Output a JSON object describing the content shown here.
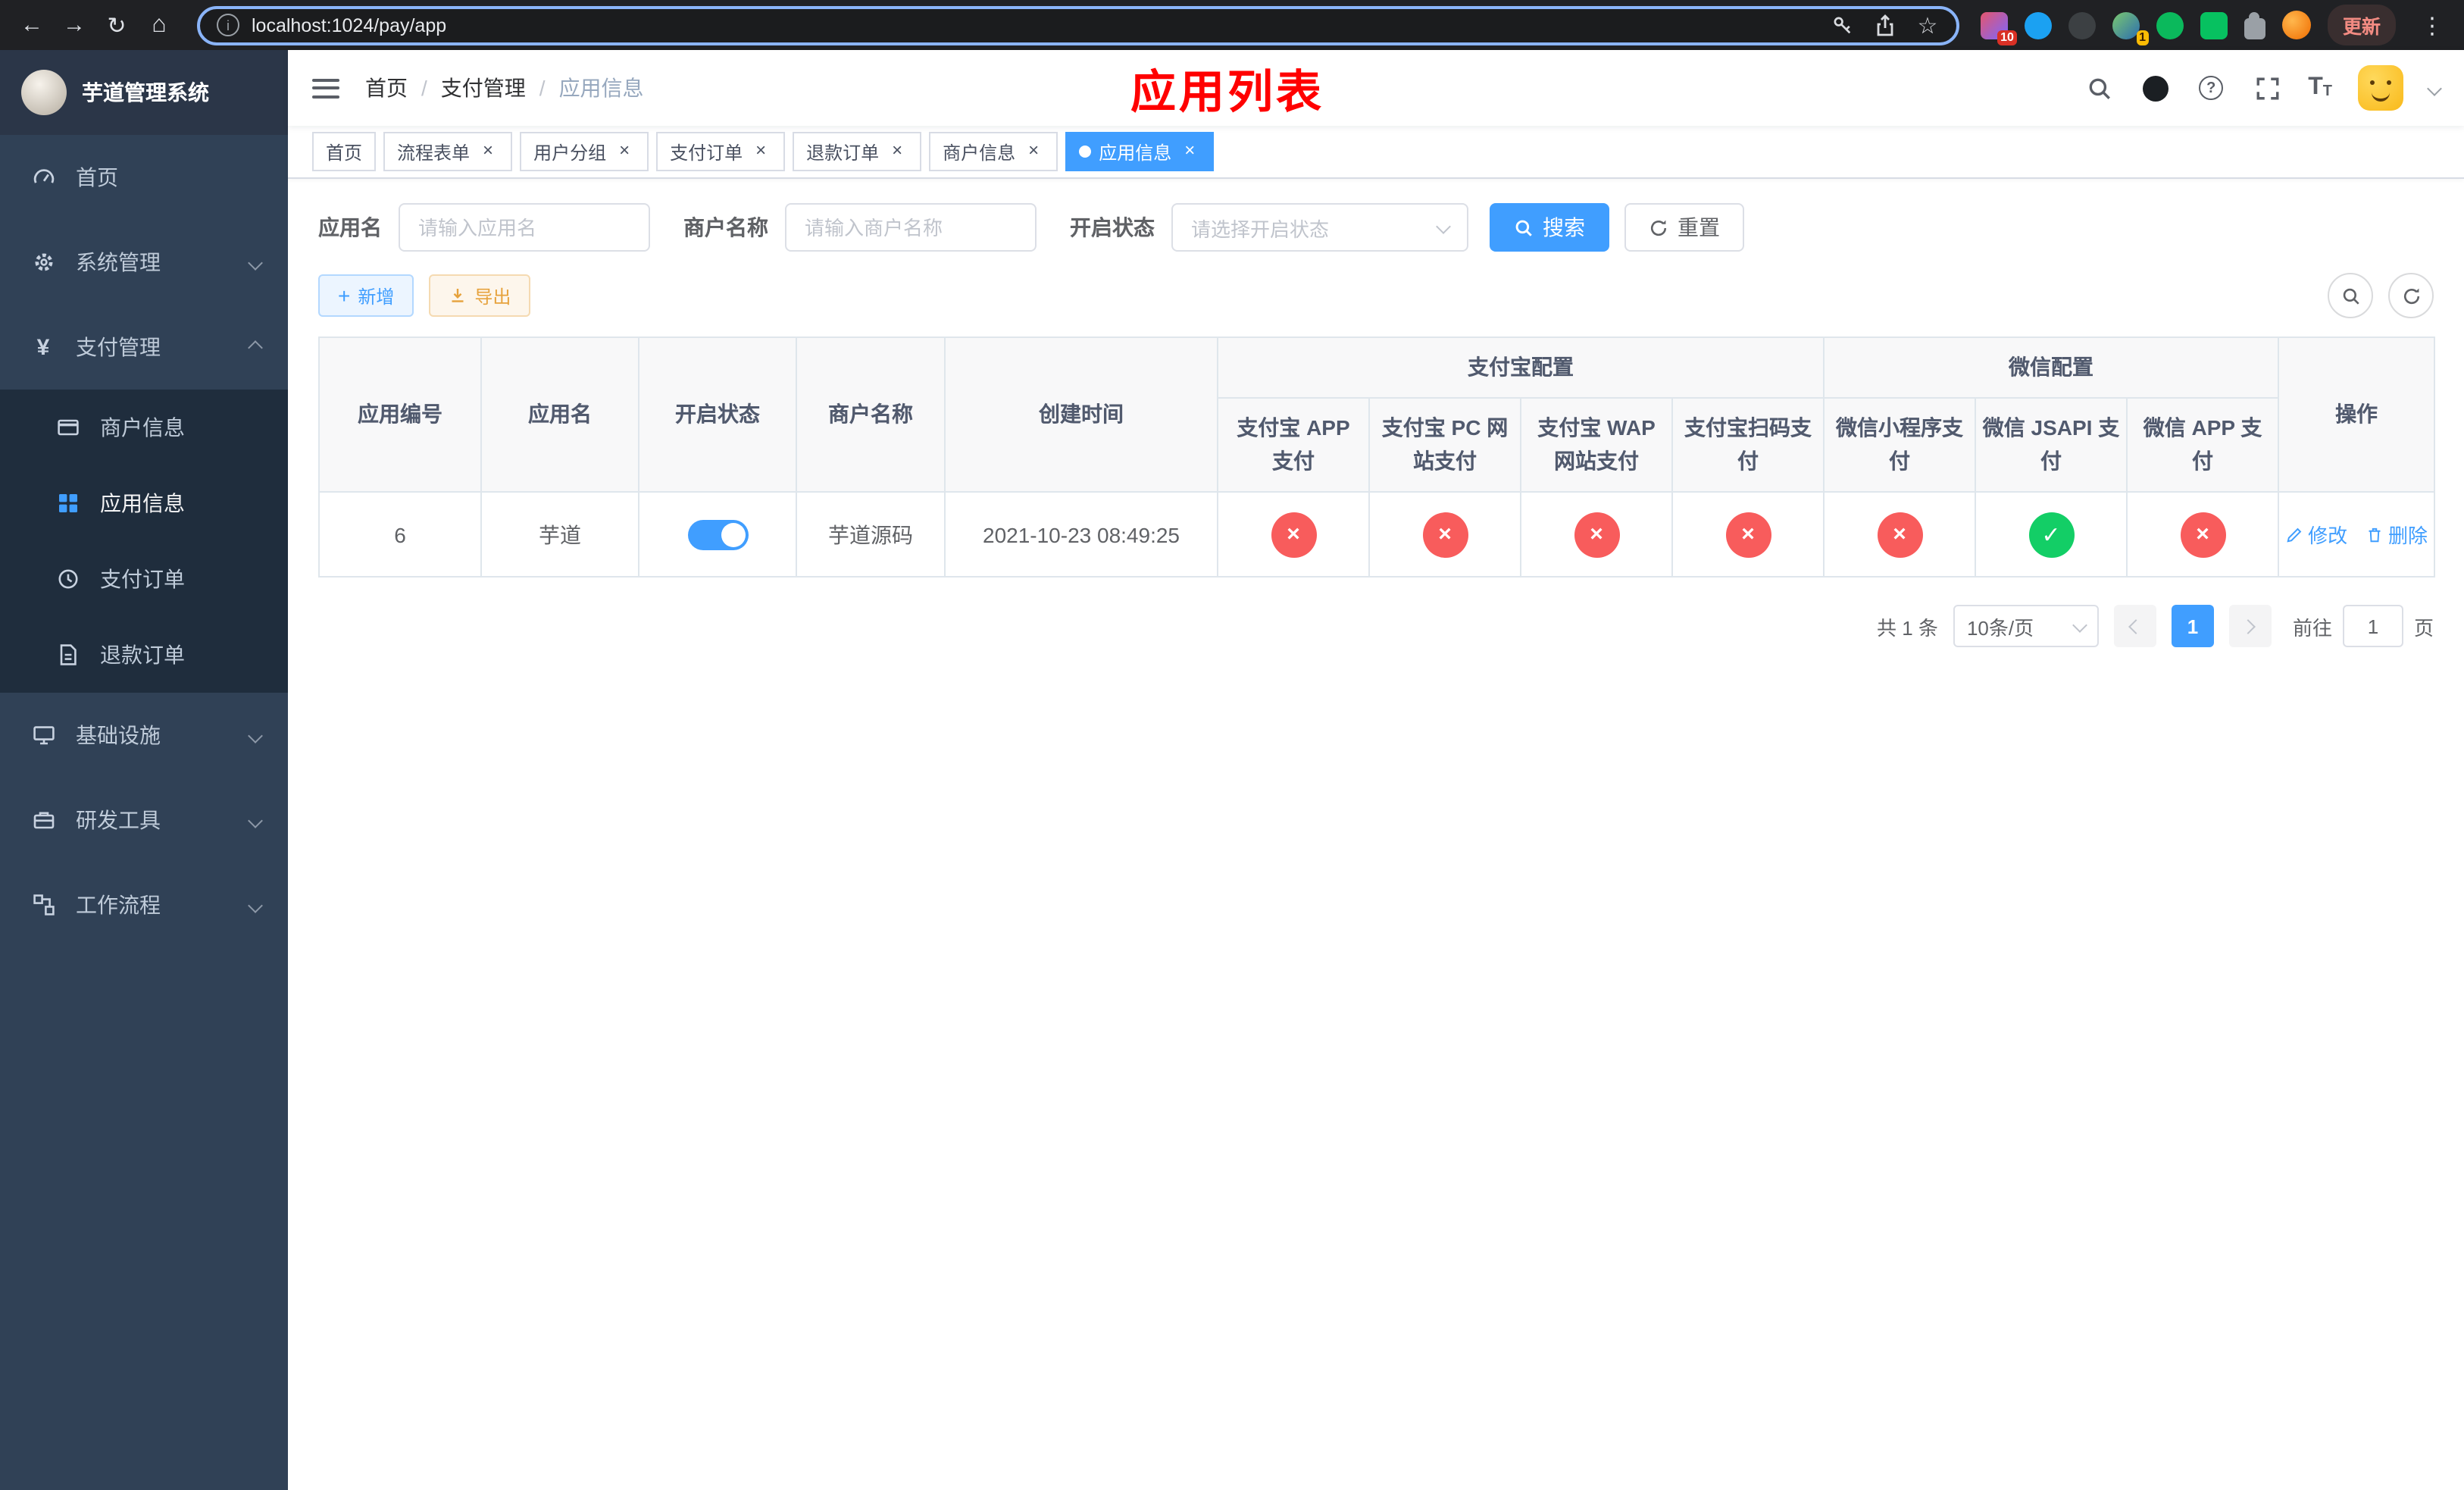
{
  "browser": {
    "url": "localhost:1024/pay/app",
    "update_button": "更新",
    "ext_badge_1": "10",
    "ext_badge_2": "1"
  },
  "sidebar": {
    "app_title": "芋道管理系统",
    "menu": [
      {
        "label": "首页"
      },
      {
        "label": "系统管理"
      },
      {
        "label": "支付管理"
      },
      {
        "label": "基础设施"
      },
      {
        "label": "研发工具"
      },
      {
        "label": "工作流程"
      }
    ],
    "submenu_pay": [
      {
        "label": "商户信息"
      },
      {
        "label": "应用信息",
        "active": true
      },
      {
        "label": "支付订单"
      },
      {
        "label": "退款订单"
      }
    ]
  },
  "header": {
    "breadcrumb": [
      {
        "label": "首页"
      },
      {
        "label": "支付管理"
      },
      {
        "label": "应用信息"
      }
    ],
    "separator": "/",
    "page_title": "应用列表"
  },
  "tabs": [
    {
      "label": "首页"
    },
    {
      "label": "流程表单"
    },
    {
      "label": "用户分组"
    },
    {
      "label": "支付订单"
    },
    {
      "label": "退款订单"
    },
    {
      "label": "商户信息"
    },
    {
      "label": "应用信息",
      "active": true
    }
  ],
  "filters": {
    "app_name": {
      "label": "应用名",
      "placeholder": "请输入应用名",
      "value": ""
    },
    "merchant_name": {
      "label": "商户名称",
      "placeholder": "请输入商户名称",
      "value": ""
    },
    "status": {
      "label": "开启状态",
      "placeholder": "请选择开启状态",
      "value": ""
    },
    "search": "搜索",
    "reset": "重置"
  },
  "toolbar": {
    "add": "新增",
    "export": "导出"
  },
  "table": {
    "columns": {
      "id": "应用编号",
      "name": "应用名",
      "status": "开启状态",
      "merchant": "商户名称",
      "created": "创建时间",
      "actions": "操作",
      "alipay_group": "支付宝配置",
      "wechat_group": "微信配置",
      "alipay_app": "支付宝 APP 支付",
      "alipay_pc": "支付宝 PC 网站支付",
      "alipay_wap": "支付宝 WAP 网站支付",
      "alipay_qr": "支付宝扫码支付",
      "wx_mini": "微信小程序支付",
      "wx_jsapi": "微信 JSAPI 支付",
      "wx_app": "微信 APP 支付"
    },
    "rows": [
      {
        "id": "6",
        "name": "芋道",
        "status_on": true,
        "merchant": "芋道源码",
        "created": "2021-10-23 08:49:25",
        "alipay_app": false,
        "alipay_pc": false,
        "alipay_wap": false,
        "alipay_qr": false,
        "wx_mini": false,
        "wx_jsapi": true,
        "wx_app": false,
        "edit": "修改",
        "delete": "删除"
      }
    ]
  },
  "pagination": {
    "total": "共 1 条",
    "page_size": "10条/页",
    "page": "1",
    "goto_label": "前往",
    "goto_value": "1",
    "goto_suffix": "页"
  },
  "colors": {
    "accent": "#409eff",
    "success": "#13ce66",
    "danger": "#f85c5c",
    "warning": "#e6a23c",
    "title_red": "#ff0000",
    "sidebar_bg": "#304156",
    "submenu_bg": "#1f2d3d",
    "chrome_bg": "#202124"
  }
}
